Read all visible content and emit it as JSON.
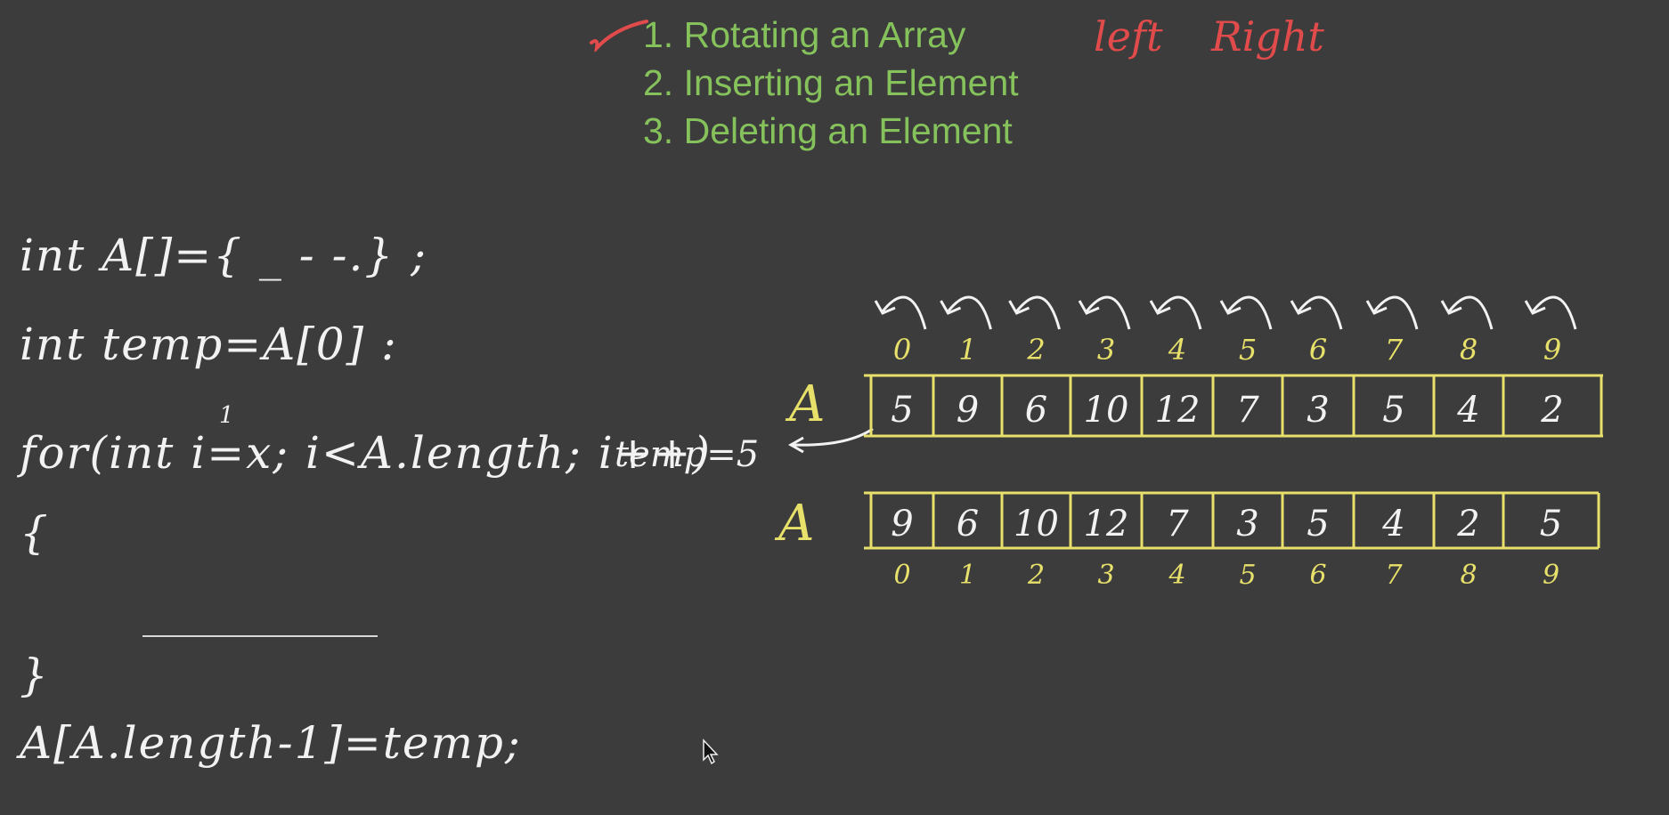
{
  "topics": [
    "1. Rotating an Array",
    "2. Inserting an Element",
    "3. Deleting an Element"
  ],
  "annotations": {
    "left": "left",
    "right": "Right"
  },
  "code": {
    "line1": "int A[]={ _  - -.} ;",
    "line2": "int  temp=A[0] :",
    "line3": "for(int i=x; i<A.length; i++)",
    "line4": "{",
    "line5": "}",
    "line6": "A[A.length-1]=temp;",
    "i_start": "1"
  },
  "temp_note": "temp=5",
  "array_before": {
    "label": "A",
    "indices": [
      "0",
      "1",
      "2",
      "3",
      "4",
      "5",
      "6",
      "7",
      "8",
      "9"
    ],
    "values": [
      "5",
      "9",
      "6",
      "10",
      "12",
      "7",
      "3",
      "5",
      "4",
      "2"
    ]
  },
  "array_after": {
    "label": "A",
    "indices": [
      "0",
      "1",
      "2",
      "3",
      "4",
      "5",
      "6",
      "7",
      "8",
      "9"
    ],
    "values": [
      "9",
      "6",
      "10",
      "12",
      "7",
      "3",
      "5",
      "4",
      "2",
      "5"
    ]
  },
  "colors": {
    "background": "#3c3c3c",
    "topic_green": "#86c25c",
    "annotation_red": "#e14b4b",
    "chalk_white": "#f2f2f2",
    "array_yellow": "#e7e06a"
  }
}
